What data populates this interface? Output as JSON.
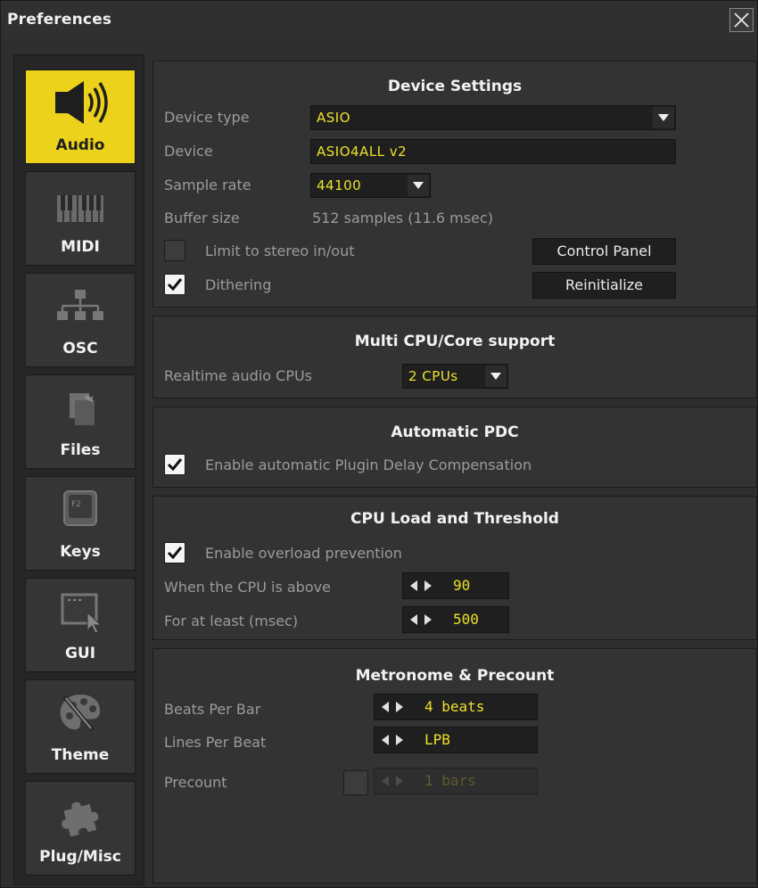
{
  "window": {
    "title": "Preferences"
  },
  "sidebar": {
    "items": [
      {
        "label": "Audio",
        "icon": "speaker-icon",
        "active": true
      },
      {
        "label": "MIDI",
        "icon": "piano-keys-icon"
      },
      {
        "label": "OSC",
        "icon": "network-icon"
      },
      {
        "label": "Files",
        "icon": "files-icon"
      },
      {
        "label": "Keys",
        "icon": "keyboard-key-icon"
      },
      {
        "label": "GUI",
        "icon": "gui-window-icon"
      },
      {
        "label": "Theme",
        "icon": "palette-icon"
      },
      {
        "label": "Plug/Misc",
        "icon": "puzzle-icon"
      }
    ]
  },
  "device_settings": {
    "title": "Device Settings",
    "device_type_label": "Device type",
    "device_type_value": "ASIO",
    "device_label": "Device",
    "device_value": "ASIO4ALL v2",
    "sample_rate_label": "Sample rate",
    "sample_rate_value": "44100",
    "buffer_size_label": "Buffer size",
    "buffer_size_value": "512 samples (11.6 msec)",
    "limit_stereo_label": "Limit to stereo in/out",
    "limit_stereo_checked": false,
    "dithering_label": "Dithering",
    "dithering_checked": true,
    "control_panel_button": "Control Panel",
    "reinitialize_button": "Reinitialize"
  },
  "multi_cpu": {
    "title": "Multi CPU/Core support",
    "realtime_cpus_label": "Realtime audio CPUs",
    "realtime_cpus_value": "2 CPUs"
  },
  "pdc": {
    "title": "Automatic PDC",
    "enable_label": "Enable automatic Plugin Delay Compensation",
    "enable_checked": true
  },
  "cpu_load": {
    "title": "CPU Load and Threshold",
    "overload_label": "Enable overload prevention",
    "overload_checked": true,
    "cpu_above_label": "When the CPU is above",
    "cpu_above_value": "90",
    "at_least_label": "For at least (msec)",
    "at_least_value": "500"
  },
  "metronome": {
    "title": "Metronome & Precount",
    "beats_per_bar_label": "Beats Per Bar",
    "beats_per_bar_value": "4 beats",
    "lines_per_beat_label": "Lines Per Beat",
    "lines_per_beat_value": "LPB",
    "precount_label": "Precount",
    "precount_checked": false,
    "precount_value": "1 bars"
  },
  "colors": {
    "accent": "#ecd21a",
    "value_text": "#ede12b",
    "panel_bg": "#333333"
  }
}
